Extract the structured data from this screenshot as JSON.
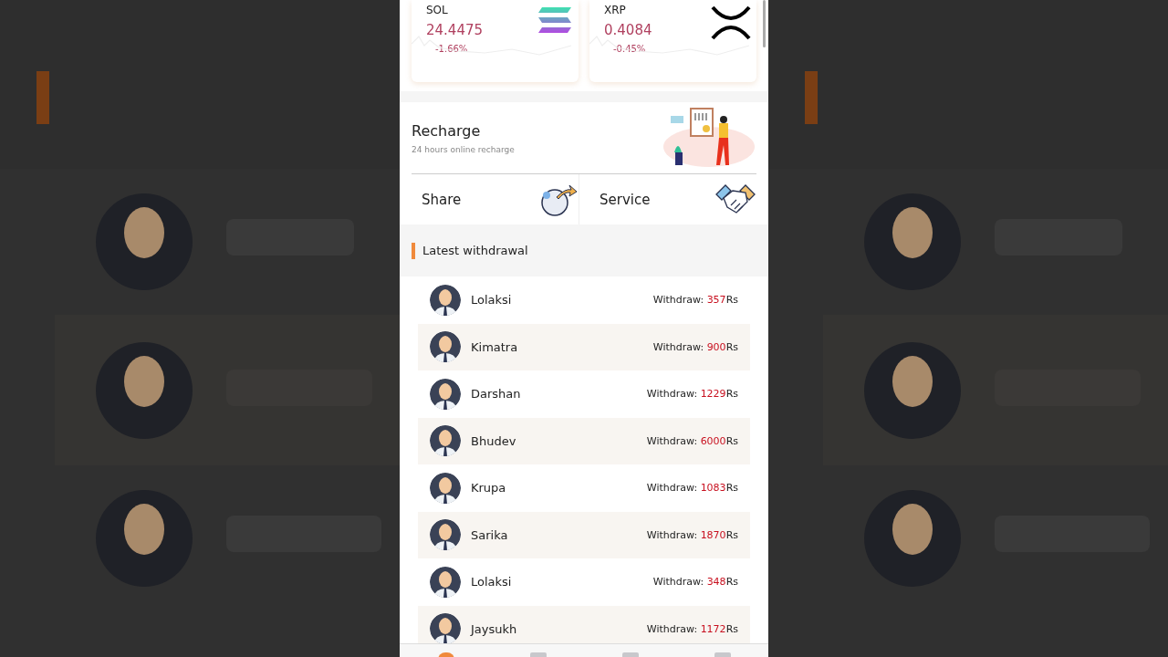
{
  "coins": [
    {
      "kind": "sol",
      "symbol": "SOL",
      "price": "24.4475",
      "change": "-1.66%"
    },
    {
      "kind": "xrp",
      "symbol": "XRP",
      "price": "0.4084",
      "change": "-0.45%"
    }
  ],
  "recharge": {
    "title": "Recharge",
    "subtitle": "24 hours online recharge"
  },
  "shortcuts": [
    {
      "kind": "share",
      "label": "Share"
    },
    {
      "kind": "service",
      "label": "Service"
    }
  ],
  "withdrawals": {
    "title": "Latest withdrawal",
    "rows": [
      {
        "name": "Lolaksi",
        "label": "Withdraw:",
        "amount": "357",
        "unit": "Rs"
      },
      {
        "name": "Kimatra",
        "label": "Withdraw:",
        "amount": "900",
        "unit": "Rs"
      },
      {
        "name": "Darshan",
        "label": "Withdraw:",
        "amount": "1229",
        "unit": "Rs"
      },
      {
        "name": "Bhudev",
        "label": "Withdraw:",
        "amount": "6000",
        "unit": "Rs"
      },
      {
        "name": "Krupa",
        "label": "Withdraw:",
        "amount": "1083",
        "unit": "Rs"
      },
      {
        "name": "Sarika",
        "label": "Withdraw:",
        "amount": "1870",
        "unit": "Rs"
      },
      {
        "name": "Lolaksi",
        "label": "Withdraw:",
        "amount": "348",
        "unit": "Rs"
      },
      {
        "name": "Jaysukh",
        "label": "Withdraw:",
        "amount": "1172",
        "unit": "Rs"
      }
    ]
  },
  "nav_items": [
    {
      "selected": true
    },
    {
      "selected": false
    },
    {
      "selected": false
    },
    {
      "selected": false
    }
  ]
}
